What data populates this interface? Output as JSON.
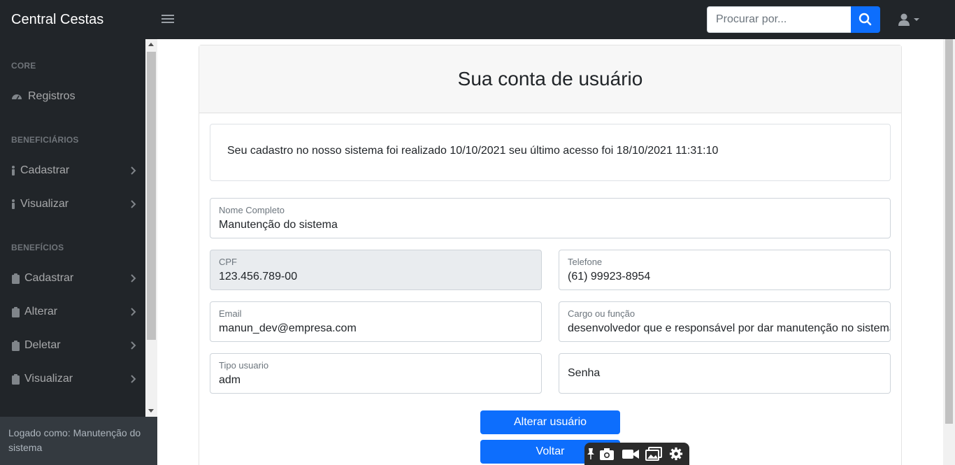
{
  "app": {
    "brand": "Central Cestas"
  },
  "topnav": {
    "search_placeholder": "Procurar por...",
    "icons": [
      "menu-icon",
      "search-icon",
      "user-icon",
      "caret-down-icon"
    ]
  },
  "sidebar": {
    "core_heading": "CORE",
    "registros": "Registros",
    "beneficiarios_heading": "BENEFICIÁRIOS",
    "ben_cadastrar": "Cadastrar",
    "ben_visualizar": "Visualizar",
    "beneficios_heading": "BENEFÍCIOS",
    "bf_cadastrar": "Cadastrar",
    "bf_alterar": "Alterar",
    "bf_deletar": "Deletar",
    "bf_visualizar": "Visualizar",
    "footer": "Logado como: Manutenção do sistema"
  },
  "page": {
    "title": "Sua conta de usuário",
    "info": "Seu cadastro no nosso sistema foi realizado 10/10/2021 seu último acesso foi 18/10/2021 11:31:10"
  },
  "form": {
    "nome_label": "Nome Completo",
    "nome_value": "Manutenção do sistema",
    "cpf_label": "CPF",
    "cpf_value": "123.456.789-00",
    "telefone_label": "Telefone",
    "telefone_value": "(61) 99923-8954",
    "email_label": "Email",
    "email_value": "manun_dev@empresa.com",
    "cargo_label": "Cargo ou função",
    "cargo_value": "desenvolvedor que e responsável por dar manutenção no sistema",
    "tipo_label": "Tipo usuario",
    "tipo_value": "adm",
    "senha_placeholder": "Senha",
    "alterar_button": "Alterar usuário",
    "voltar_button": "Voltar"
  },
  "colors": {
    "primary": "#0d6efd",
    "dark": "#212529",
    "sidebar_footer": "#343a40"
  }
}
